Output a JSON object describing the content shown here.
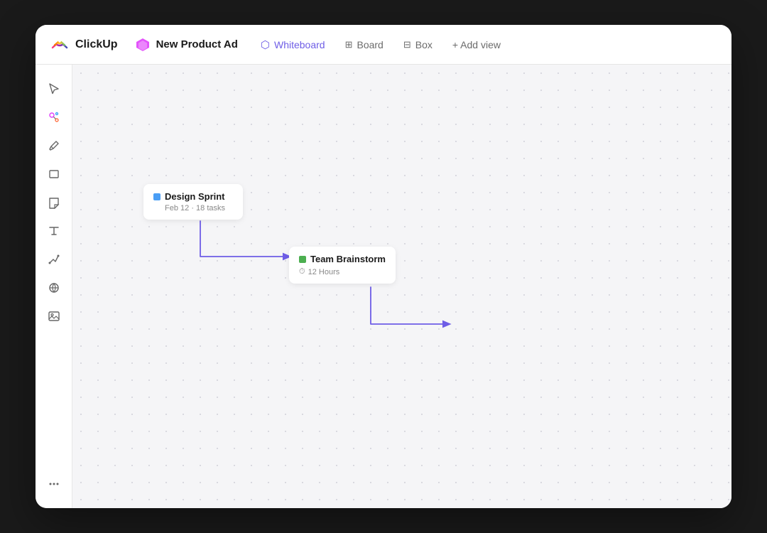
{
  "app": {
    "name": "ClickUp"
  },
  "header": {
    "project_icon_color": "#e040fb",
    "project_name": "New Product Ad",
    "tabs": [
      {
        "id": "whiteboard",
        "label": "Whiteboard",
        "icon": "⬡",
        "active": true,
        "color": "#6e5de6"
      },
      {
        "id": "board",
        "label": "Board",
        "icon": "⊞",
        "active": false
      },
      {
        "id": "box",
        "label": "Box",
        "icon": "⊟",
        "active": false
      }
    ],
    "add_view_label": "+ Add view"
  },
  "sidebar": {
    "tools": [
      {
        "id": "cursor",
        "label": "Cursor"
      },
      {
        "id": "magic",
        "label": "Magic"
      },
      {
        "id": "pen",
        "label": "Pen"
      },
      {
        "id": "rectangle",
        "label": "Rectangle"
      },
      {
        "id": "sticky",
        "label": "Sticky Note"
      },
      {
        "id": "text",
        "label": "Text"
      },
      {
        "id": "connector",
        "label": "Connector"
      },
      {
        "id": "globe",
        "label": "Globe"
      },
      {
        "id": "image",
        "label": "Image"
      },
      {
        "id": "more",
        "label": "More"
      }
    ]
  },
  "canvas": {
    "cards": [
      {
        "id": "design-sprint",
        "title": "Design Sprint",
        "dot_color": "blue",
        "meta_date": "Feb 12",
        "meta_tasks": "18 tasks"
      },
      {
        "id": "team-brainstorm",
        "title": "Team Brainstorm",
        "dot_color": "green",
        "meta_icon": "⏱",
        "meta_text": "12 Hours"
      }
    ]
  }
}
